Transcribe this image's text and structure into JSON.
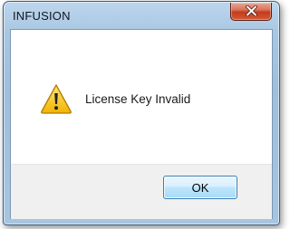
{
  "window": {
    "title": "INFUSION",
    "close_icon": "close-icon"
  },
  "message": {
    "icon": "warning-icon",
    "text": "License Key Invalid"
  },
  "buttons": {
    "ok_label": "OK"
  },
  "colors": {
    "frame": "#a9c7e3",
    "close_button": "#c43b1d",
    "warning_yellow": "#f5c400",
    "button_area": "#f0f0f0"
  }
}
